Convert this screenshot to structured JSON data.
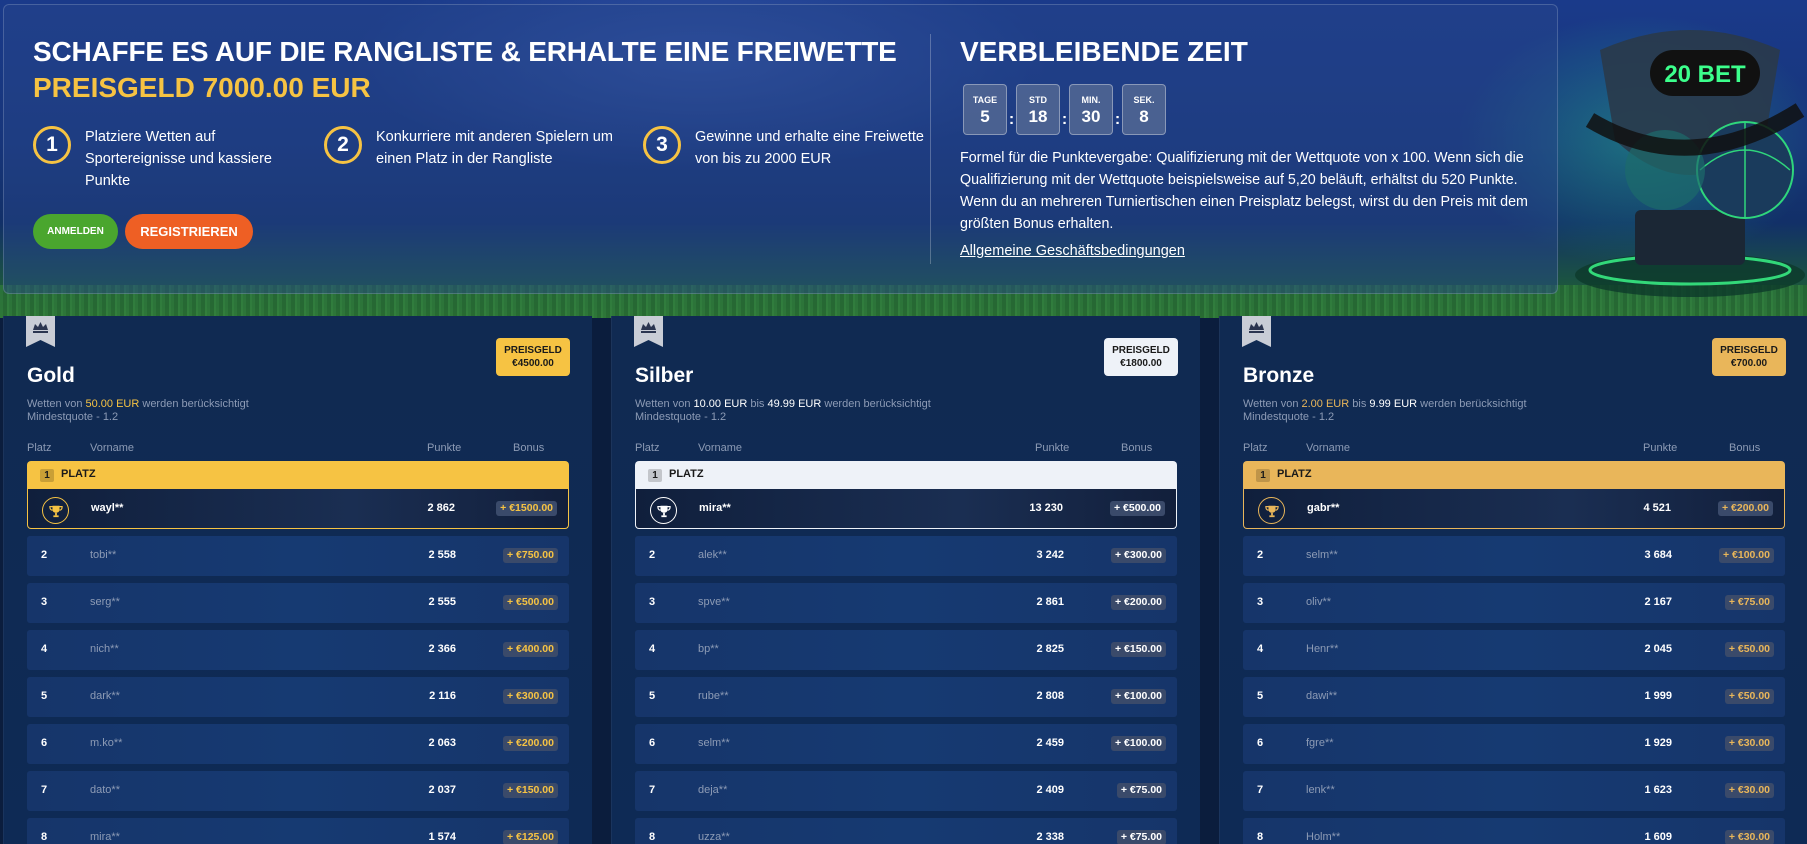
{
  "hero": {
    "title_line1": "SCHAFFE ES AUF DIE RANGLISTE & ERHALTE EINE FREIWETTE",
    "title_line2": "PREISGELD 7000.00 EUR",
    "steps": [
      {
        "num": "1",
        "text": "Platziere Wetten auf Sportereignisse und kassiere Punkte"
      },
      {
        "num": "2",
        "text": "Konkurriere mit anderen Spielern um einen Platz in der Rangliste"
      },
      {
        "num": "3",
        "text": "Gewinne und erhalte eine Freiwette von bis zu 2000 EUR"
      }
    ],
    "login_label": "ANMELDEN",
    "register_label": "REGISTRIEREN"
  },
  "timer": {
    "title": "VERBLEIBENDE ZEIT",
    "days_label": "TAGE",
    "days": "5",
    "hours_label": "STD",
    "hours": "18",
    "minutes_label": "MIN.",
    "minutes": "30",
    "seconds_label": "SEK.",
    "seconds": "8",
    "separator": ":",
    "formula": "Formel für die Punktevergabe: Qualifizierung mit der Wettquote von x 100. Wenn sich die Qualifizierung mit der Wettquote beispielsweise auf 5,20 beläuft, erhältst du 520 Punkte. Wenn du an mehreren Turniertischen einen Preisplatz belegst, wirst du den Preis mit dem größten Bonus erhalten.",
    "terms_link": "Allgemeine Geschäftsbedingungen"
  },
  "brand_logo_text": "20 BET",
  "columns": {
    "place": "Platz",
    "name": "Vorname",
    "points": "Punkte",
    "bonus": "Bonus"
  },
  "place_label": "PLATZ",
  "boards": [
    {
      "name": "Gold",
      "accent": "#f6c343",
      "prize_label": "PREISGELD",
      "prize_value": "€4500.00",
      "cond_prefix": "Wetten von ",
      "cond_from": "50.00 EUR",
      "cond_mid": "",
      "cond_to": "",
      "cond_suffix": " werden berücksichtigt",
      "min_quote": "Mindestquote - 1.2",
      "rows": [
        {
          "pos": "1",
          "name": "wayl**",
          "points": "2 862",
          "bonus": "+ €1500.00"
        },
        {
          "pos": "2",
          "name": "tobi**",
          "points": "2 558",
          "bonus": "+ €750.00"
        },
        {
          "pos": "3",
          "name": "serg**",
          "points": "2 555",
          "bonus": "+ €500.00"
        },
        {
          "pos": "4",
          "name": "nich**",
          "points": "2 366",
          "bonus": "+ €400.00"
        },
        {
          "pos": "5",
          "name": "dark**",
          "points": "2 116",
          "bonus": "+ €300.00"
        },
        {
          "pos": "6",
          "name": "m.ko**",
          "points": "2 063",
          "bonus": "+ €200.00"
        },
        {
          "pos": "7",
          "name": "dato**",
          "points": "2 037",
          "bonus": "+ €150.00"
        },
        {
          "pos": "8",
          "name": "mira**",
          "points": "1 574",
          "bonus": "+ €125.00"
        }
      ]
    },
    {
      "name": "Silber",
      "accent": "#eef2f8",
      "prize_label": "PREISGELD",
      "prize_value": "€1800.00",
      "cond_prefix": "Wetten von ",
      "cond_from": "10.00 EUR",
      "cond_mid": " bis ",
      "cond_to": "49.99 EUR",
      "cond_suffix": " werden berücksichtigt",
      "min_quote": "Mindestquote - 1.2",
      "rows": [
        {
          "pos": "1",
          "name": "mira**",
          "points": "13 230",
          "bonus": "+ €500.00"
        },
        {
          "pos": "2",
          "name": "alek**",
          "points": "3 242",
          "bonus": "+ €300.00"
        },
        {
          "pos": "3",
          "name": "spve**",
          "points": "2 861",
          "bonus": "+ €200.00"
        },
        {
          "pos": "4",
          "name": "bp**",
          "points": "2 825",
          "bonus": "+ €150.00"
        },
        {
          "pos": "5",
          "name": "rube**",
          "points": "2 808",
          "bonus": "+ €100.00"
        },
        {
          "pos": "6",
          "name": "selm**",
          "points": "2 459",
          "bonus": "+ €100.00"
        },
        {
          "pos": "7",
          "name": "deja**",
          "points": "2 409",
          "bonus": "+ €75.00"
        },
        {
          "pos": "8",
          "name": "uzza**",
          "points": "2 338",
          "bonus": "+ €75.00"
        }
      ]
    },
    {
      "name": "Bronze",
      "accent": "#e9b65a",
      "prize_label": "PREISGELD",
      "prize_value": "€700.00",
      "cond_prefix": "Wetten von ",
      "cond_from": "2.00 EUR",
      "cond_mid": " bis ",
      "cond_to": "9.99 EUR",
      "cond_suffix": " werden berücksichtigt",
      "min_quote": "Mindestquote - 1.2",
      "rows": [
        {
          "pos": "1",
          "name": "gabr**",
          "points": "4 521",
          "bonus": "+ €200.00"
        },
        {
          "pos": "2",
          "name": "selm**",
          "points": "3 684",
          "bonus": "+ €100.00"
        },
        {
          "pos": "3",
          "name": "oliv**",
          "points": "2 167",
          "bonus": "+ €75.00"
        },
        {
          "pos": "4",
          "name": "Henr**",
          "points": "2 045",
          "bonus": "+ €50.00"
        },
        {
          "pos": "5",
          "name": "dawi**",
          "points": "1 999",
          "bonus": "+ €50.00"
        },
        {
          "pos": "6",
          "name": "fgre**",
          "points": "1 929",
          "bonus": "+ €30.00"
        },
        {
          "pos": "7",
          "name": "lenk**",
          "points": "1 623",
          "bonus": "+ €30.00"
        },
        {
          "pos": "8",
          "name": "Holm**",
          "points": "1 609",
          "bonus": "+ €30.00"
        }
      ]
    }
  ]
}
